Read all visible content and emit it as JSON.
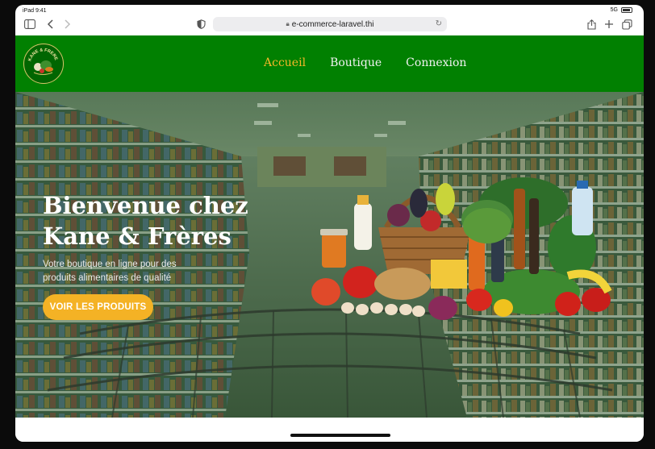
{
  "status_bar": {
    "time": "iPad 9:41",
    "signal": "5G"
  },
  "browser": {
    "url": "e-commerce-laravel.thi"
  },
  "icons": {
    "sidebar": "sidebar-icon",
    "back": "chevron-left-icon",
    "forward": "chevron-right-icon",
    "privacy": "privacy-shield-icon",
    "lock": "lock-icon",
    "reload": "reload-icon",
    "share": "share-icon",
    "new_tab": "plus-icon",
    "tabs": "tabs-icon"
  },
  "site": {
    "logo_text": "KANE & FRERE",
    "nav": [
      {
        "label": "Accueil",
        "active": true
      },
      {
        "label": "Boutique",
        "active": false
      },
      {
        "label": "Connexion",
        "active": false
      }
    ]
  },
  "hero": {
    "title_line1": "Bienvenue chez",
    "title_line2": "Kane & Frères",
    "subtitle": "Votre boutique en ligne pour des produits alimentaires de qualité",
    "cta": "VOIR LES PRODUITS"
  },
  "colors": {
    "nav_bg": "#018001",
    "accent": "#f5b728",
    "hero_overlay": "#3f6b3f"
  }
}
